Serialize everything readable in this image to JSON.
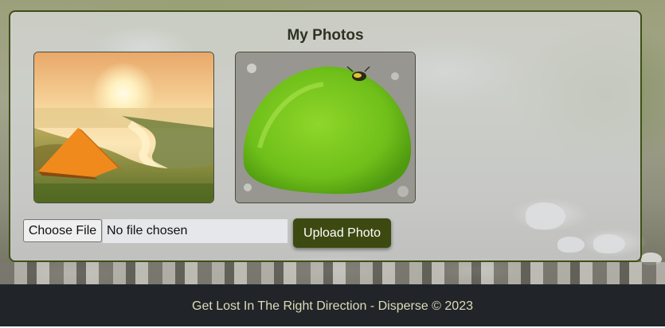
{
  "gallery": {
    "title": "My Photos",
    "photos": [
      {
        "subject": "orange tent on grassy hill at sunset"
      },
      {
        "subject": "green moss clump with insect"
      }
    ]
  },
  "upload": {
    "choose_file_label": "Choose File",
    "file_status": "No file chosen",
    "upload_label": "Upload Photo"
  },
  "footer": {
    "text": "Get Lost In The Right Direction - Disperse © 2023"
  },
  "colors": {
    "accent": "#3c4a12",
    "card_border": "#3f4f16",
    "footer_bg": "#212529",
    "footer_text": "#dcdcb8"
  }
}
